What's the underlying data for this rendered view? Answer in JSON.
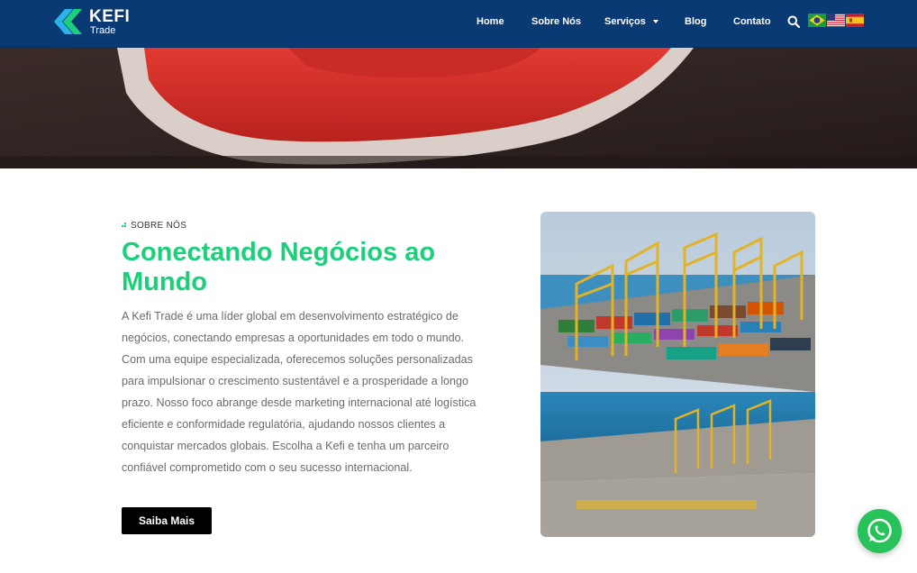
{
  "brand": {
    "name": "KEFI",
    "sub": "Trade",
    "accent": "#1ccf7a",
    "header_bg": "#0a3a73"
  },
  "nav": {
    "items": [
      {
        "label": "Home"
      },
      {
        "label": "Sobre Nós"
      },
      {
        "label": "Serviços"
      },
      {
        "label": "Blog"
      },
      {
        "label": "Contato"
      }
    ],
    "search_icon": "search-icon",
    "languages": [
      "pt-BR",
      "en-US",
      "es"
    ]
  },
  "about": {
    "eyebrow": "SOBRE NÓS",
    "title": "Conectando Negócios ao Mundo",
    "body": "A Kefi Trade é uma líder global em desenvolvimento estratégico de negócios, conectando empresas a oportunidades em todo o mundo. Com uma equipe especializada, oferecemos soluções personalizadas para impulsionar o crescimento sustentável e a prosperidade a longo prazo. Nosso foco abrange desde marketing internacional até logística eficiente e conformidade regulatória, ajudando nossos clientes a conquistar mercados globais. Escolha a Kefi e tenha um parceiro confiável comprometido com o seu sucesso internacional.",
    "cta_label": "Saiba Mais"
  },
  "widgets": {
    "chat_icon": "whatsapp-icon",
    "chat_color": "#27c35a"
  }
}
